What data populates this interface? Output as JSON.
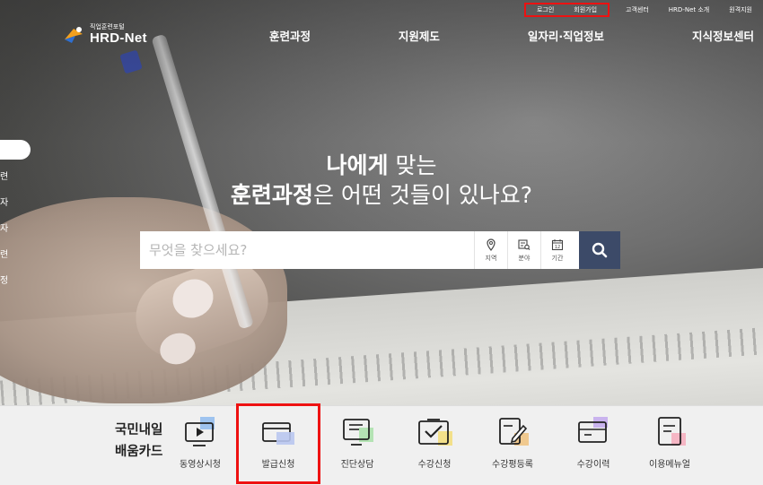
{
  "top_links": {
    "login": "로그인",
    "signup": "회원가입",
    "customer_center": "고객센터",
    "about": "HRD-Net 소개",
    "remote_support": "원격지원"
  },
  "logo": {
    "subtitle": "직업훈련포털",
    "name": "HRD-Net"
  },
  "nav": {
    "items": [
      "훈련과정",
      "지원제도",
      "일자리·직업정보",
      "지식정보센터"
    ]
  },
  "side": {
    "chars": [
      "련",
      "자",
      "자",
      "련",
      "정"
    ]
  },
  "hero": {
    "line1_bold": "나에게",
    "line1_rest": " 맞는",
    "line2_bold": "훈련과정",
    "line2_rest": "은 어떤 것들이 있나요?"
  },
  "search": {
    "placeholder": "무엇을 찾으세요?",
    "filters": [
      "지역",
      "분야",
      "기간"
    ],
    "button_icon": "search-icon"
  },
  "card": {
    "title_line1": "국민내일",
    "title_line2": "배움카드"
  },
  "quick_menu": [
    {
      "label": "동영상시청",
      "icon": "video-icon"
    },
    {
      "label": "발급신청",
      "icon": "card-icon"
    },
    {
      "label": "진단상담",
      "icon": "consult-icon"
    },
    {
      "label": "수강신청",
      "icon": "enroll-icon"
    },
    {
      "label": "수강평등록",
      "icon": "review-icon"
    },
    {
      "label": "수강이력",
      "icon": "history-icon"
    },
    {
      "label": "이용메뉴얼",
      "icon": "manual-icon"
    }
  ],
  "colors": {
    "search_button": "#3c4a68",
    "highlight": "#e11111"
  }
}
